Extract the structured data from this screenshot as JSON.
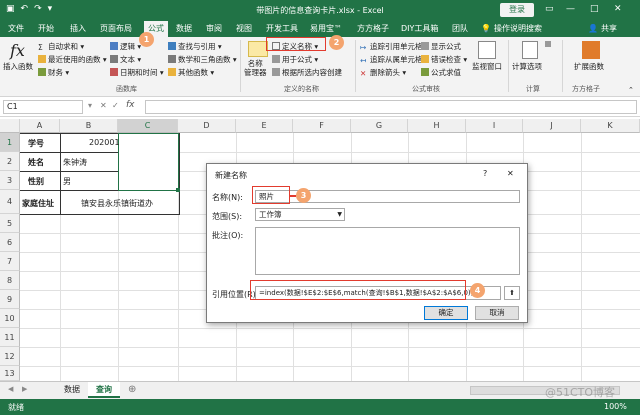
{
  "window": {
    "doc_title": "带图片的信息查询卡片.xlsx - Excel",
    "login_label": "登录",
    "controls": [
      "—",
      "□",
      "✕"
    ],
    "ribbon_toggle": "▭"
  },
  "tabs": [
    {
      "label": "文件"
    },
    {
      "label": "开始"
    },
    {
      "label": "插入"
    },
    {
      "label": "页面布局"
    },
    {
      "label": "公式"
    },
    {
      "label": "数据"
    },
    {
      "label": "审阅"
    },
    {
      "label": "视图"
    },
    {
      "label": "开发工具"
    },
    {
      "label": "易用宝™"
    },
    {
      "label": "方方格子"
    },
    {
      "label": "DIY工具箱"
    },
    {
      "label": "团队"
    },
    {
      "label": "操作说明搜索"
    },
    {
      "label": "共享"
    }
  ],
  "ribbon": {
    "insert_function": "插入函数",
    "autosum": "自动求和 ▾",
    "recent": "最近使用的函数 ▾",
    "finance": "财务 ▾",
    "logic": "逻辑 ▾",
    "text": "文本 ▾",
    "datetime": "日期和时间 ▾",
    "lookup": "查找与引用 ▾",
    "math": "数学和三角函数 ▾",
    "other": "其他函数 ▾",
    "group_library": "函数库",
    "define_name": "定义名称 ▾",
    "name_manager": "名称\n管理器",
    "use_in_formula": "用于公式 ▾",
    "create_from_sel": "根据所选内容创建",
    "group_names": "定义的名称",
    "trace_prec": "追踪引用单元格",
    "trace_dep": "追踪从属单元格",
    "remove_arrows": "删除箭头 ▾",
    "show_formulas": "显示公式",
    "error_check": "错误检查 ▾",
    "eval_formula": "公式求值",
    "watch": "监视窗口",
    "group_audit": "公式审核",
    "calc_options": "计算选项",
    "group_calc": "计算",
    "ext_func": "扩展函数",
    "group_ff": "方方格子"
  },
  "formula_bar": {
    "name_box": "C1",
    "fx": "fx"
  },
  "columns": [
    "A",
    "B",
    "C",
    "D",
    "E",
    "F",
    "G",
    "H",
    "I",
    "J",
    "K"
  ],
  "rows": [
    "1",
    "2",
    "3",
    "4",
    "5",
    "6",
    "7",
    "8",
    "9",
    "10",
    "11",
    "12",
    "13",
    "14",
    "15",
    "16"
  ],
  "cells": {
    "a1": "学号",
    "b1": "202001",
    "a2": "姓名",
    "b2": "朱钟涛",
    "a3": "性别",
    "b3": "男",
    "a4": "家庭住址",
    "b4": "镇安县永乐镇街道办"
  },
  "sheets": {
    "nav_prev": "◀",
    "nav_next": "▶",
    "tabs": [
      {
        "label": "数据"
      },
      {
        "label": "查询"
      }
    ],
    "add": "⊕"
  },
  "status": {
    "ready": "就绪",
    "zoom": "100%"
  },
  "dialog": {
    "title": "新建名称",
    "help": "?",
    "close": "✕",
    "name_label": "名称(N):",
    "name_value": "照片",
    "scope_label": "范围(S):",
    "scope_value": "工作簿",
    "comment_label": "批注(O):",
    "ref_label": "引用位置(R):",
    "ref_value": "=index(数据!$E$2:$E$6,match(查询!$B$1,数据!$A$2:$A$6,0))",
    "ok": "确定",
    "cancel": "取消"
  },
  "callouts": [
    "1",
    "2",
    "3",
    "4"
  ],
  "watermark": "@51CTO博客",
  "colors": {
    "excel_green": "#217346",
    "callout": "#f4a46e",
    "highlight_red": "#e23b2e"
  }
}
